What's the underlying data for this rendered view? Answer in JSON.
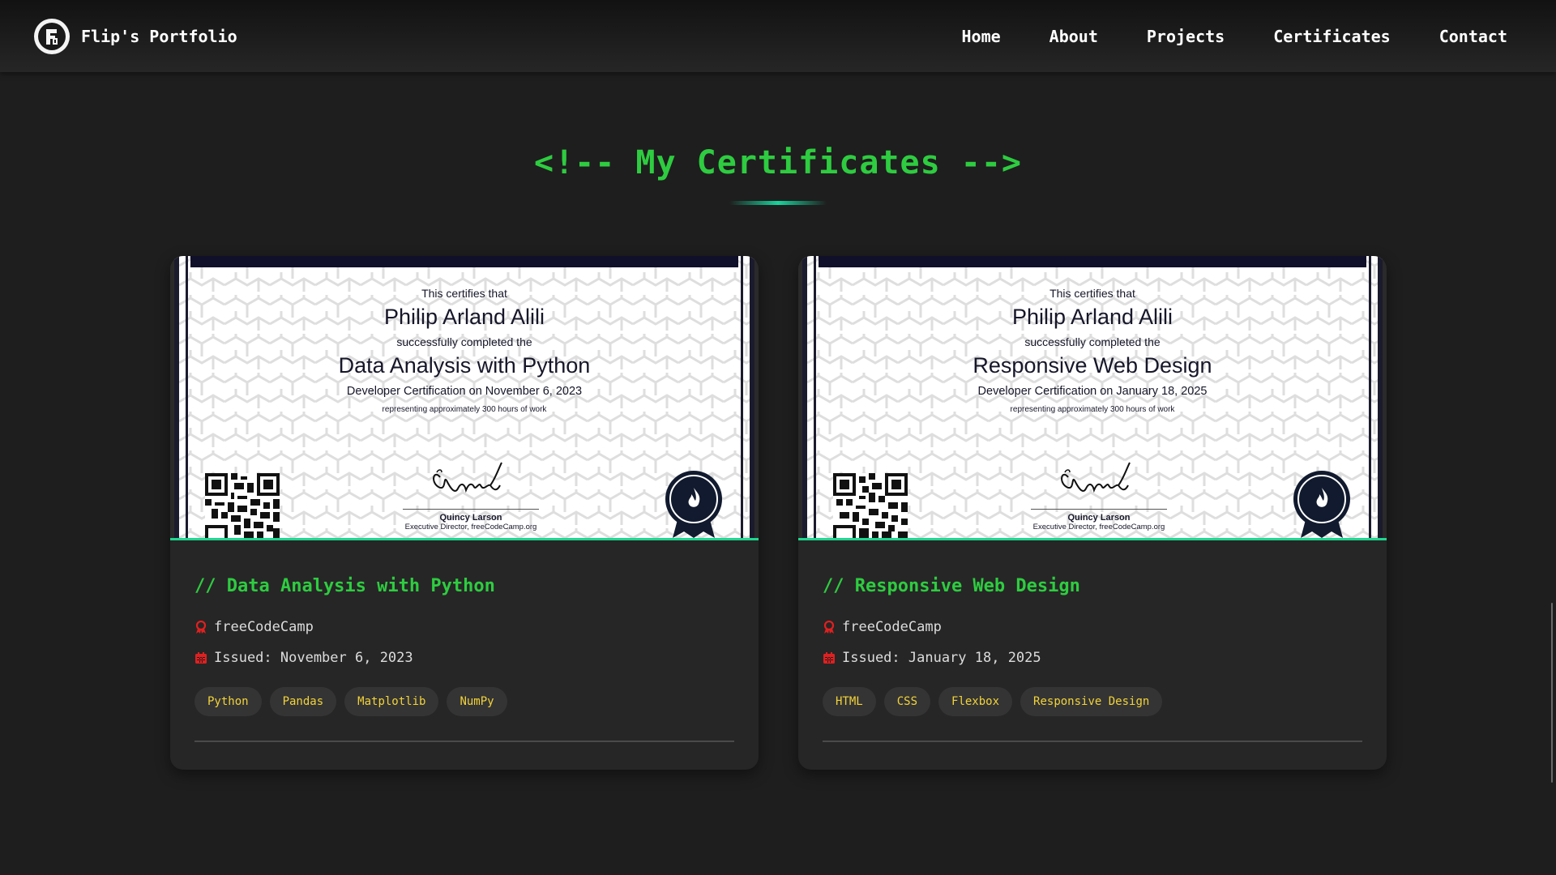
{
  "header": {
    "brand": "Flip's Portfolio",
    "nav": [
      "Home",
      "About",
      "Projects",
      "Certificates",
      "Contact"
    ]
  },
  "section": {
    "title": "<!-- My Certificates -->"
  },
  "certificates": [
    {
      "image": {
        "certifies": "This certifies that",
        "recipient": "Philip Arland Alili",
        "completed": "successfully completed the",
        "course": "Data Analysis with Python",
        "certification": "Developer Certification on November 6, 2023",
        "hours": "representing approximately 300 hours of work",
        "signer": "Quincy Larson",
        "signer_role": "Executive Director, freeCodeCamp.org"
      },
      "title": "// Data Analysis with Python",
      "issuer": "freeCodeCamp",
      "issued": "Issued: November 6, 2023",
      "tags": [
        "Python",
        "Pandas",
        "Matplotlib",
        "NumPy"
      ]
    },
    {
      "image": {
        "certifies": "This certifies that",
        "recipient": "Philip Arland Alili",
        "completed": "successfully completed the",
        "course": "Responsive Web Design",
        "certification": "Developer Certification on January 18, 2025",
        "hours": "representing approximately 300 hours of work",
        "signer": "Quincy Larson",
        "signer_role": "Executive Director, freeCodeCamp.org"
      },
      "title": "// Responsive Web Design",
      "issuer": "freeCodeCamp",
      "issued": "Issued: January 18, 2025",
      "tags": [
        "HTML",
        "CSS",
        "Flexbox",
        "Responsive Design"
      ]
    }
  ],
  "colors": {
    "accent_green": "#2ecc40",
    "tag_text": "#f2d33a",
    "icon_red": "#e02020",
    "progress_gradient": [
      "#16e39a",
      "#1aa0f0"
    ]
  },
  "icons": {
    "issuer": "award-icon",
    "issued": "calendar-icon"
  },
  "scroll_progress": 0.88
}
